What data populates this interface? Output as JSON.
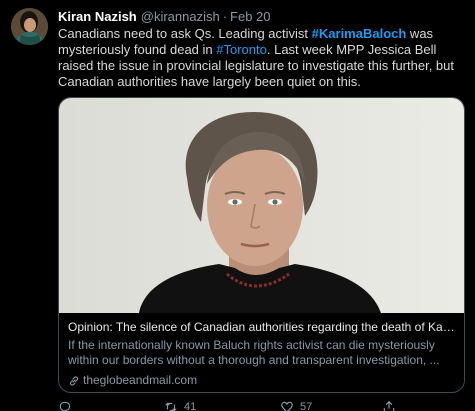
{
  "tweet": {
    "author_name": "Kiran Nazish",
    "handle": "@kirannazish",
    "separator": "·",
    "date": "Feb 20",
    "text_part1": "Canadians need to ask Qs. Leading activist ",
    "hashtag1": "#KarimaBaloch",
    "text_part2": " was mysteriously found dead in ",
    "hashtag2": "#Toronto",
    "text_part3": ". Last week MPP Jessica Bell raised the issue in provincial legislature to investigate this further, but Canadian authorities have largely been quiet on this."
  },
  "card": {
    "title": "Opinion: The silence of Canadian authorities regarding the death of Kari...",
    "description": "If the internationally known Baluch rights activist can die mysteriously within our borders without a thorough and transparent investigation, ...",
    "domain": "theglobeandmail.com"
  },
  "actions": {
    "retweet_count": "41",
    "like_count": "57"
  },
  "colors": {
    "background": "#000000",
    "link": "#1d9bf0",
    "secondary_text": "#8b98a5",
    "card_border": "#3d4b55"
  },
  "icons": [
    "reply-icon",
    "retweet-icon",
    "like-icon",
    "share-icon",
    "link-icon"
  ]
}
